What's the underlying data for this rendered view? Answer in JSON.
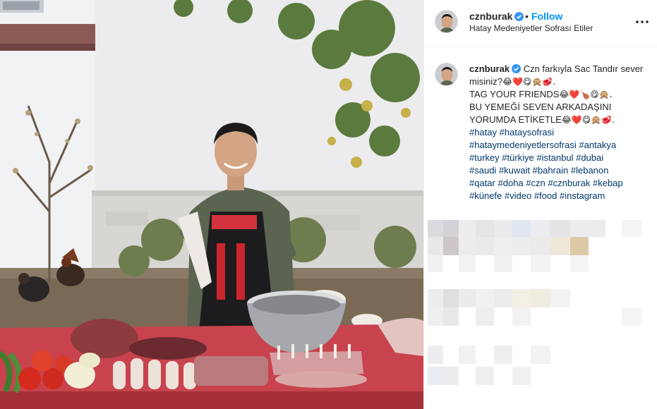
{
  "post": {
    "author": {
      "username": "cznburak",
      "verified": true,
      "location": "Hatay Medeniyetler Sofrası Etiler"
    },
    "follow_label": "Follow",
    "separator": "•",
    "caption": {
      "line1": "Czn farkıyla Sac Tandır sever misiniz?",
      "line1_emoji": "😂❤️😋🙊🥩.",
      "line2": "TAG YOUR FRIENDS",
      "line2_emoji": "😂❤️🍗😋🙊.",
      "line3": "BU YEMEĞİ SEVEN ARKADAŞINI YORUMDA ETİKETLE",
      "line3_emoji": "😂❤️😋🙊🥩.",
      "hashtags": [
        "#hatay",
        "#hataysofrasi",
        "#hataymedeniyetlersofrasi",
        "#antakya",
        "#turkey",
        "#türkiye",
        "#istanbul",
        "#dubai",
        "#saudi",
        "#kuwait",
        "#bahrain",
        "#lebanon",
        "#qatar",
        "#doha",
        "#czn",
        "#cznburak",
        "#kebap",
        "#künefe",
        "#video",
        "#food",
        "#instagram"
      ]
    }
  },
  "icons": {
    "verified": "verified-badge-icon",
    "more": "more-options-icon"
  },
  "colors": {
    "link_blue": "#0095f6",
    "hashtag": "#00376b",
    "verified": "#3897f0",
    "table_red": "#c8434e"
  }
}
